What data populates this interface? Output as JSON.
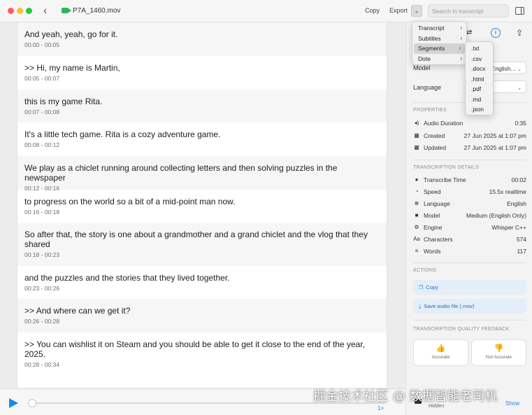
{
  "window": {
    "file_title": "P7A_1460.mov",
    "copy_label": "Copy",
    "export_label": "Export",
    "search_placeholder": "Search in transcript"
  },
  "segments": [
    {
      "text": "And yeah, yeah, go for it.",
      "time": "00:00 - 00:05"
    },
    {
      "text": ">> Hi, my name is Martin,",
      "time": "00:05 - 00:07"
    },
    {
      "text": "this is my game Rita.",
      "time": "00:07 - 00:08"
    },
    {
      "text": "It's a little tech game. Rita is a cozy adventure game.",
      "time": "00:08 - 00:12"
    },
    {
      "text": "We play as a chiclet running around collecting letters and then solving puzzles in the newspaper",
      "time": "00:12 - 00:16"
    },
    {
      "text": "to progress on the world so a bit of a mid-point man now.",
      "time": "00:16 - 00:18"
    },
    {
      "text": "So after that, the story is one about a grandmother and a grand chiclet and the vlog that they shared",
      "time": "00:18 - 00:23"
    },
    {
      "text": "and the puzzles and the stories that they lived together.",
      "time": "00:23 - 00:26"
    },
    {
      "text": ">> And where can we get it?",
      "time": "00:26 - 00:28"
    },
    {
      "text": ">> You can wishlist it on Steam and you should be able to get it close to the end of the year, 2025.",
      "time": "00:28 - 00:34"
    }
  ],
  "player": {
    "speed": "1×",
    "progress": 0
  },
  "panel": {
    "model_label": "Model",
    "model_value": "English...",
    "language_label": "Language",
    "properties_header": "PROPERTIES",
    "properties": [
      {
        "icon": "speaker-icon",
        "label": "Audio Duration",
        "value": "0:35"
      },
      {
        "icon": "calendar-icon",
        "label": "Created",
        "value": "27 Jun 2025 at 1:07 pm"
      },
      {
        "icon": "calendar-icon",
        "label": "Updated",
        "value": "27 Jun 2025 at 1:07 pm"
      }
    ],
    "details_header": "TRANSCRIPTION DETAILS",
    "details": [
      {
        "icon": "clock-icon",
        "label": "Transcribe Time",
        "value": "00:02"
      },
      {
        "icon": "gauge-icon",
        "label": "Speed",
        "value": "15.5x realtime"
      },
      {
        "icon": "globe-icon",
        "label": "Language",
        "value": "English"
      },
      {
        "icon": "cube-icon",
        "label": "Model",
        "value": "Medium (English Only)"
      },
      {
        "icon": "gear-icon",
        "label": "Engine",
        "value": "Whisper C++"
      },
      {
        "icon": "text-icon",
        "label": "Characters",
        "value": "574"
      },
      {
        "icon": "list-icon",
        "label": "Words",
        "value": "117"
      }
    ],
    "actions_header": "ACTIONS",
    "action_copy": "Copy",
    "action_save": "Save audio file (.mov)",
    "feedback_header": "TRANSCRIPTION QUALITY FEEDBACK",
    "feedback_accurate": "Accurate",
    "feedback_not_accurate": "Not Accurate",
    "video_hidden": "Hidden",
    "video_show": "Show"
  },
  "export_menu": {
    "items": [
      {
        "label": "Transcript"
      },
      {
        "label": "Subtitles"
      },
      {
        "label": "Segments"
      },
      {
        "label": "Dote"
      }
    ],
    "submenu": [
      ".txt",
      ".csv",
      ".docx",
      ".html",
      ".pdf",
      ".md",
      ".json"
    ]
  },
  "watermark": "掘金技术社区 @ 数据智能老司机",
  "colors": {
    "accent": "#1e88e5",
    "background": "#f6f6f6"
  }
}
